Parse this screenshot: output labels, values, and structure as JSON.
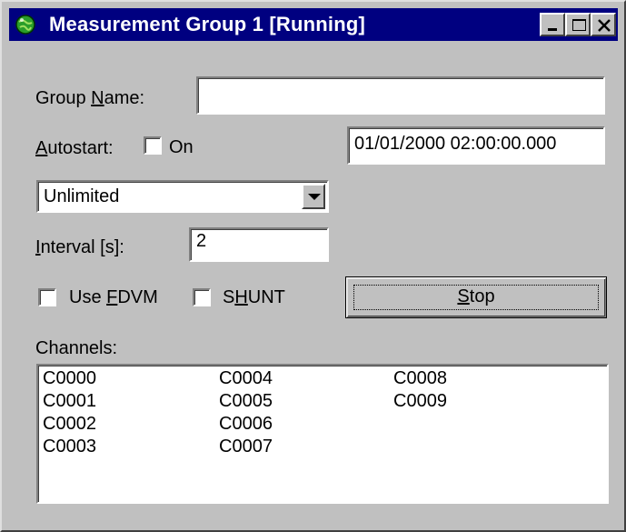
{
  "window": {
    "title": "Measurement Group 1 [Running]",
    "titlebar_color": "#000080",
    "controls": [
      "minimize-icon",
      "maximize-icon",
      "close-icon"
    ]
  },
  "form": {
    "group_name_label_pre": "Group ",
    "group_name_label_u": "N",
    "group_name_label_post": "ame:",
    "group_name_value": "",
    "autostart_label_u": "A",
    "autostart_label_post": "utostart:",
    "on_label": "On",
    "on_checked": false,
    "datetime_value": "01/01/2000 02:00:00.000",
    "mode_selected": "Unlimited",
    "interval_label_u": "I",
    "interval_label_post": "nterval [s]:",
    "interval_value": "2",
    "use_fdvm_pre": "Use ",
    "use_fdvm_u": "F",
    "use_fdvm_post": "DVM",
    "use_fdvm_checked": false,
    "shunt_pre": "S",
    "shunt_u": "H",
    "shunt_post": "UNT",
    "shunt_checked": false,
    "stop_u": "S",
    "stop_post": "top"
  },
  "channels": {
    "label": "Channels:",
    "items": [
      "C0000",
      "C0001",
      "C0002",
      "C0003",
      "C0004",
      "C0005",
      "C0006",
      "C0007",
      "C0008",
      "C0009"
    ]
  }
}
